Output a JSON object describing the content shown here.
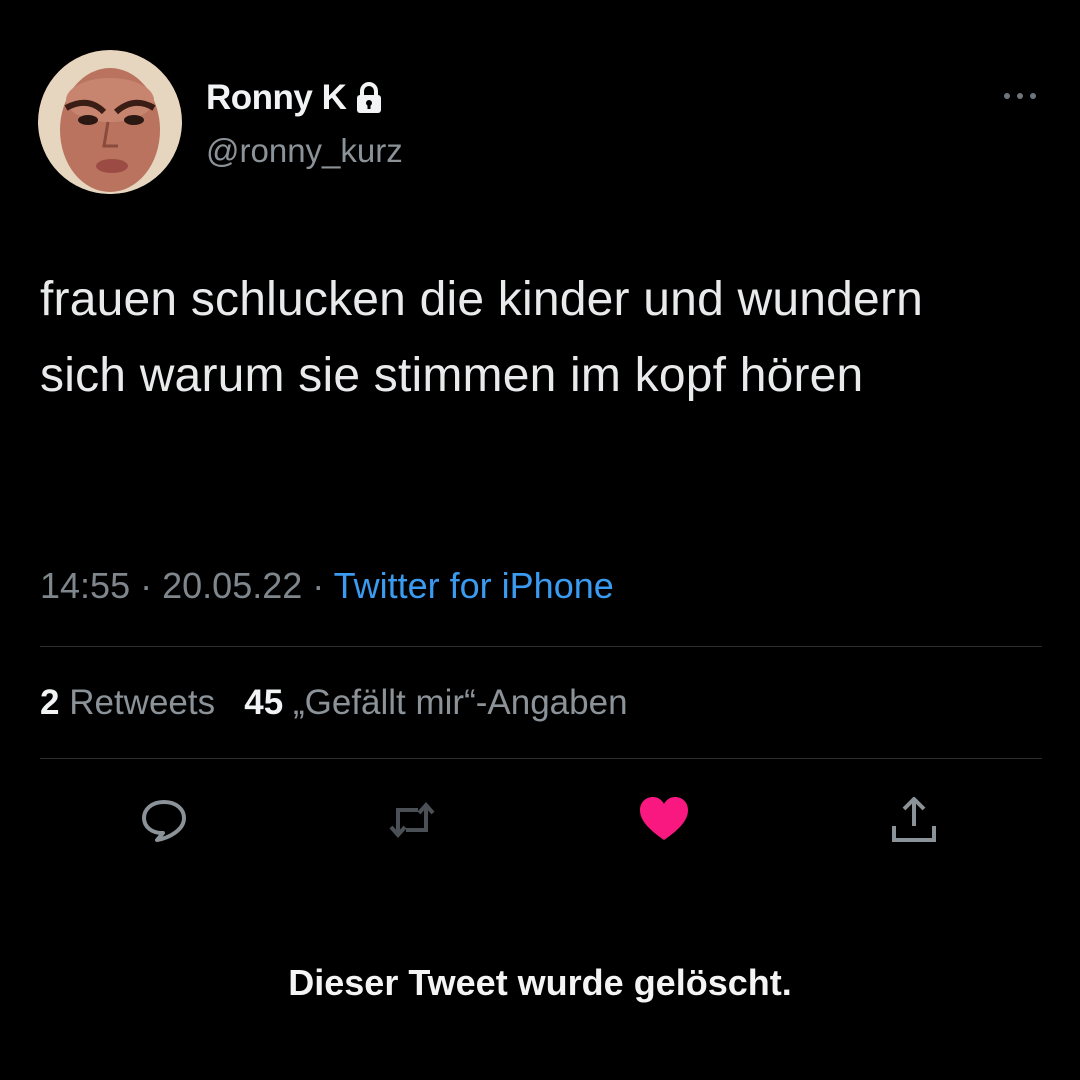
{
  "user": {
    "display_name": "Ronny K",
    "handle": "@ronny_kurz",
    "avatar_icon": "profile-photo",
    "protected_icon": "lock-icon"
  },
  "header": {
    "more_icon": "more-horizontal-icon"
  },
  "tweet": {
    "text": "frauen schlucken die kinder und wundern sich warum sie stimmen im kopf hören",
    "time": "14:55",
    "date": "20.05.22",
    "separator": "·",
    "source": "Twitter for iPhone"
  },
  "stats": {
    "retweets_count": "2",
    "retweets_label": "Retweets",
    "likes_count": "45",
    "likes_label": "„Gefällt mir“-Angaben"
  },
  "actions": {
    "reply_icon": "reply-bubble-icon",
    "retweet_icon": "retweet-icon",
    "like_icon": "heart-icon",
    "share_icon": "share-icon",
    "like_active": true
  },
  "footer": {
    "deleted_notice": "Dieser Tweet wurde gelöscht."
  },
  "colors": {
    "background": "#000000",
    "primary_text": "#e7e9ea",
    "secondary_text": "#7f868c",
    "link": "#3a9bf0",
    "like_active": "#f91880",
    "divider": "#2a2d30"
  }
}
